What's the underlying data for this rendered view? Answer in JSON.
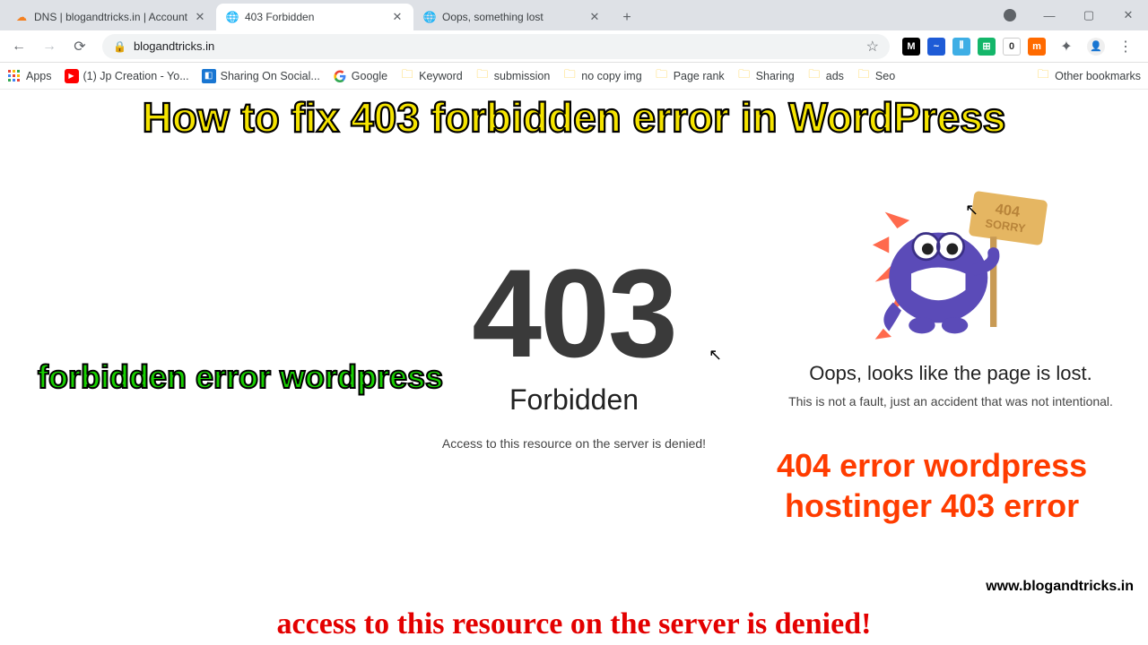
{
  "tabs": [
    {
      "title": "DNS | blogandtricks.in | Account",
      "favcolor": "#f48020",
      "favglyph": "☁"
    },
    {
      "title": "403 Forbidden",
      "favcolor": "#5f6368",
      "favglyph": "◉"
    },
    {
      "title": "Oops, something lost",
      "favcolor": "#5f6368",
      "favglyph": "◉"
    }
  ],
  "toolbar": {
    "url": "blogandtricks.in"
  },
  "bookmarks": {
    "apps": "Apps",
    "items": [
      {
        "label": "(1) Jp Creation - Yo...",
        "iconbg": "#ff0000",
        "glyph": "▶"
      },
      {
        "label": "Sharing On Social...",
        "iconbg": "#1976d2",
        "glyph": "◧"
      },
      {
        "label": "Google",
        "iconbg": "#ffffff",
        "glyph": "G"
      },
      {
        "label": "Keyword",
        "iconbg": "folder",
        "glyph": ""
      },
      {
        "label": "submission",
        "iconbg": "folder",
        "glyph": ""
      },
      {
        "label": "no copy img",
        "iconbg": "folder",
        "glyph": ""
      },
      {
        "label": "Page rank",
        "iconbg": "folder",
        "glyph": ""
      },
      {
        "label": "Sharing",
        "iconbg": "folder",
        "glyph": ""
      },
      {
        "label": "ads",
        "iconbg": "folder",
        "glyph": ""
      },
      {
        "label": "Seo",
        "iconbg": "folder",
        "glyph": ""
      }
    ],
    "other": "Other bookmarks"
  },
  "page": {
    "code": "403",
    "forbidden": "Forbidden",
    "denied": "Access to this resource on the server is denied!",
    "oops": "Oops, looks like the page is lost.",
    "oops_sub": "This is not a fault, just an accident that was not intentional.",
    "sign": "404\nSORRY"
  },
  "captions": {
    "title": "How to fix 403 forbidden error in WordPress",
    "left": "forbidden error wordpress",
    "right1": "404 error wordpress",
    "right2": "hostinger 403 error",
    "bottom": "access to this resource on the server is denied!",
    "url": "www.blogandtricks.in"
  }
}
